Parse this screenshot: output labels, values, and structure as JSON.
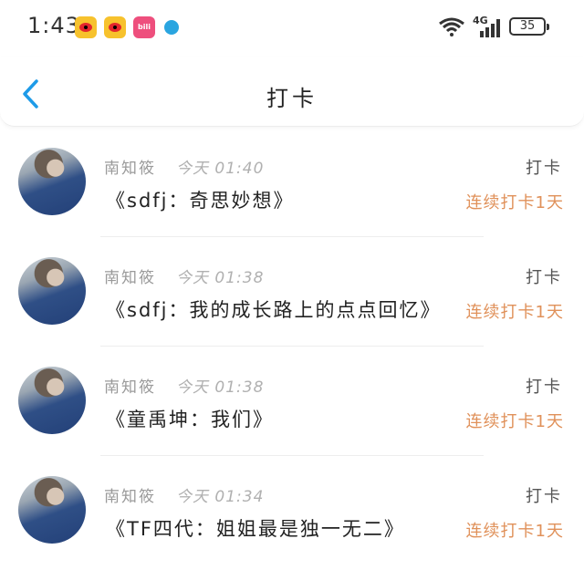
{
  "status_bar": {
    "time": "1:43",
    "network": "4G",
    "battery": "35"
  },
  "nav": {
    "title": "打卡"
  },
  "items": [
    {
      "author": "南知筱",
      "timestamp": "今天 01:40",
      "title": "《sdfj：奇思妙想》",
      "action": "打卡",
      "streak": "连续打卡1天"
    },
    {
      "author": "南知筱",
      "timestamp": "今天 01:38",
      "title": "《sdfj：我的成长路上的点点回忆》",
      "action": "打卡",
      "streak": "连续打卡1天"
    },
    {
      "author": "南知筱",
      "timestamp": "今天 01:38",
      "title": "《童禹坤：我们》",
      "action": "打卡",
      "streak": "连续打卡1天"
    },
    {
      "author": "南知筱",
      "timestamp": "今天 01:34",
      "title": "《TF四代：姐姐最是独一无二》",
      "action": "打卡",
      "streak": "连续打卡1天"
    }
  ],
  "colors": {
    "back_arrow": "#1e9be8",
    "streak": "#e0915a"
  }
}
